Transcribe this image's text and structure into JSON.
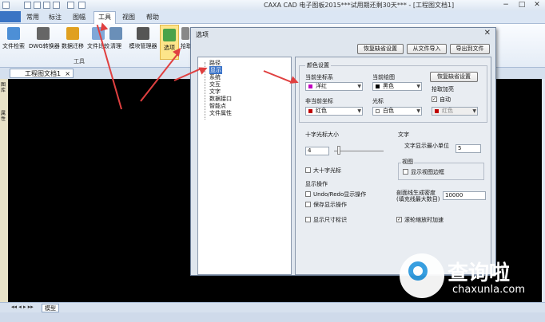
{
  "app": {
    "title": "CAXA CAD 电子图板2015***试用期还剩30天*** - [工程图文档1]",
    "min": "−",
    "max": "□",
    "close": "✕"
  },
  "ribbon_tabs": [
    "常用",
    "标注",
    "图幅",
    "工具",
    "视图",
    "帮助"
  ],
  "ribbon_buttons": [
    {
      "label": "文件检索",
      "icon": "file-search-icon",
      "color": "#4d8fd6"
    },
    {
      "label": "DWG转换器",
      "icon": "dwg-converter-icon",
      "color": "#666666"
    },
    {
      "label": "数据迁移",
      "icon": "data-migration-icon",
      "color": "#e0a020"
    },
    {
      "label": "文件比较",
      "icon": "file-compare-icon",
      "color": "#7fa7d8"
    },
    {
      "label": "清理",
      "icon": "clean-icon",
      "color": "#6a8fb8"
    },
    {
      "label": "模块管理器",
      "icon": "module-manager-icon",
      "color": "#555555"
    },
    {
      "label": "选项",
      "icon": "options-icon",
      "color": "#4aa34a"
    },
    {
      "label": "拾取",
      "icon": "pick-icon",
      "color": "#888888"
    }
  ],
  "ribbon_group_label": "工具",
  "doc_tab": "工程图文档1",
  "model_tab": "模型",
  "left_strip": [
    "图库",
    "属性"
  ],
  "dialog": {
    "title": "选项",
    "close": "✕",
    "buttons": {
      "restore_default": "恢复缺省设置",
      "import": "从文件导入",
      "export": "导出到文件"
    },
    "tree": [
      "路径",
      "显示",
      "系统",
      "交互",
      "文字",
      "数据接口",
      "智能点",
      "文件属性"
    ],
    "selected_tree": "显示",
    "color_group": "颜色设置",
    "current_coord_label": "当前坐标系",
    "current_coord_value": "洋红",
    "current_coord_color": "#c000c0",
    "current_drawing_label": "当前绘图",
    "current_drawing_value": "黑色",
    "current_drawing_color": "#000000",
    "restore_color_btn": "恢复缺省设置",
    "noncurrent_coord_label": "非当前坐标",
    "noncurrent_coord_value": "红色",
    "noncurrent_coord_color": "#c00000",
    "cursor_label": "光标",
    "cursor_value": "白色",
    "cursor_color": "#ffffff",
    "pick_highlight_label": "拾取加亮",
    "auto_label": "自动",
    "auto_checked": true,
    "pick_color_value": "红色",
    "pick_color": "#c00000",
    "crosshair_size_label": "十字光标大小",
    "crosshair_size_value": "4",
    "big_crosshair_label": "大十字光标",
    "text_group": "文字",
    "text_min_unit_label": "文字显示最小单位",
    "text_min_unit_value": "5",
    "viewport_group": "视图",
    "show_viewport_border_label": "显示视图边框",
    "display_ops_label": "显示操作",
    "undo_redo_label": "Undo/Redo显示操作",
    "save_display_label": "保存显示操作",
    "hatch_threshold_label": "剖面线生成密度(填充线最大数目)",
    "hatch_threshold_value": "10000",
    "show_dim_label": "显示尺寸标识",
    "wheel_zoom_label": "滚轮缩放时加速",
    "wheel_zoom_checked": true
  },
  "watermark": {
    "brand": "查询啦",
    "url": "chaxunla.com"
  }
}
